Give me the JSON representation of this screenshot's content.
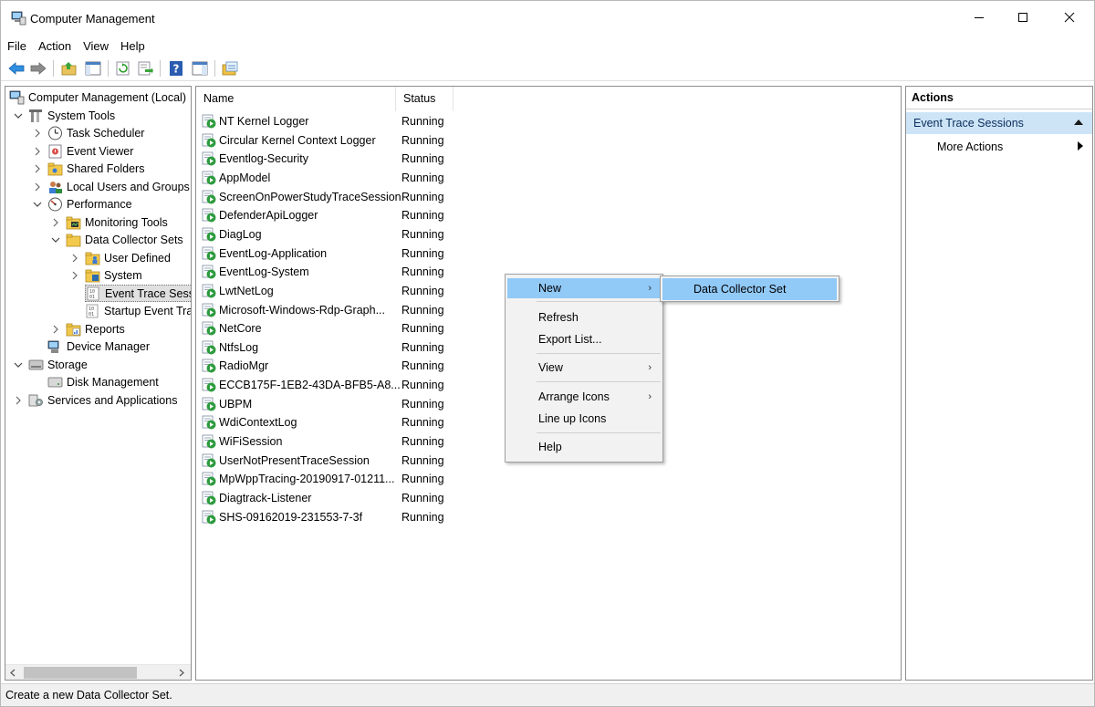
{
  "window": {
    "title": "Computer Management"
  },
  "menubar": {
    "items": [
      "File",
      "Action",
      "View",
      "Help"
    ]
  },
  "toolbar": {
    "buttons": [
      "back-icon",
      "forward-icon",
      "up-folder-icon",
      "show-hide-tree-icon",
      "refresh-icon",
      "export-list-icon",
      "help-icon",
      "show-hide-action-pane-icon",
      "new-data-collector-icon"
    ]
  },
  "tree": {
    "items": [
      {
        "label": "Computer Management (Local)",
        "icon": "computer-management-icon"
      },
      {
        "label": "System Tools",
        "icon": "system-tools-icon"
      },
      {
        "label": "Task Scheduler",
        "icon": "clock-icon"
      },
      {
        "label": "Event Viewer",
        "icon": "event-viewer-icon"
      },
      {
        "label": "Shared Folders",
        "icon": "shared-folder-icon"
      },
      {
        "label": "Local Users and Groups",
        "icon": "users-icon"
      },
      {
        "label": "Performance",
        "icon": "performance-icon"
      },
      {
        "label": "Monitoring Tools",
        "icon": "monitor-folder-icon"
      },
      {
        "label": "Data Collector Sets",
        "icon": "folder-icon"
      },
      {
        "label": "User Defined",
        "icon": "user-folder-icon"
      },
      {
        "label": "System",
        "icon": "system-folder-icon"
      },
      {
        "label": "Event Trace Sessi",
        "icon": "trace-session-icon"
      },
      {
        "label": "Startup Event Tra",
        "icon": "trace-session-icon"
      },
      {
        "label": "Reports",
        "icon": "reports-folder-icon"
      },
      {
        "label": "Device Manager",
        "icon": "device-manager-icon"
      },
      {
        "label": "Storage",
        "icon": "storage-icon"
      },
      {
        "label": "Disk Management",
        "icon": "disk-icon"
      },
      {
        "label": "Services and Applications",
        "icon": "services-icon"
      }
    ]
  },
  "list": {
    "columns": [
      "Name",
      "Status"
    ],
    "rows": [
      {
        "name": "NT Kernel Logger",
        "status": "Running"
      },
      {
        "name": "Circular Kernel Context Logger",
        "status": "Running"
      },
      {
        "name": "Eventlog-Security",
        "status": "Running"
      },
      {
        "name": "AppModel",
        "status": "Running"
      },
      {
        "name": "ScreenOnPowerStudyTraceSession",
        "status": "Running"
      },
      {
        "name": "DefenderApiLogger",
        "status": "Running"
      },
      {
        "name": "DiagLog",
        "status": "Running"
      },
      {
        "name": "EventLog-Application",
        "status": "Running"
      },
      {
        "name": "EventLog-System",
        "status": "Running"
      },
      {
        "name": "LwtNetLog",
        "status": "Running"
      },
      {
        "name": "Microsoft-Windows-Rdp-Graph...",
        "status": "Running"
      },
      {
        "name": "NetCore",
        "status": "Running"
      },
      {
        "name": "NtfsLog",
        "status": "Running"
      },
      {
        "name": "RadioMgr",
        "status": "Running"
      },
      {
        "name": "ECCB175F-1EB2-43DA-BFB5-A8...",
        "status": "Running"
      },
      {
        "name": "UBPM",
        "status": "Running"
      },
      {
        "name": "WdiContextLog",
        "status": "Running"
      },
      {
        "name": "WiFiSession",
        "status": "Running"
      },
      {
        "name": "UserNotPresentTraceSession",
        "status": "Running"
      },
      {
        "name": "MpWppTracing-20190917-01211...",
        "status": "Running"
      },
      {
        "name": "Diagtrack-Listener",
        "status": "Running"
      },
      {
        "name": "SHS-09162019-231553-7-3f",
        "status": "Running"
      }
    ]
  },
  "actions": {
    "header": "Actions",
    "group": "Event Trace Sessions",
    "more": "More Actions"
  },
  "context_menu": {
    "items": [
      "New",
      "Refresh",
      "Export List...",
      "View",
      "Arrange Icons",
      "Line up Icons",
      "Help"
    ],
    "submenu": [
      "Data Collector Set"
    ]
  },
  "statusbar": {
    "text": "Create a new Data Collector Set."
  }
}
